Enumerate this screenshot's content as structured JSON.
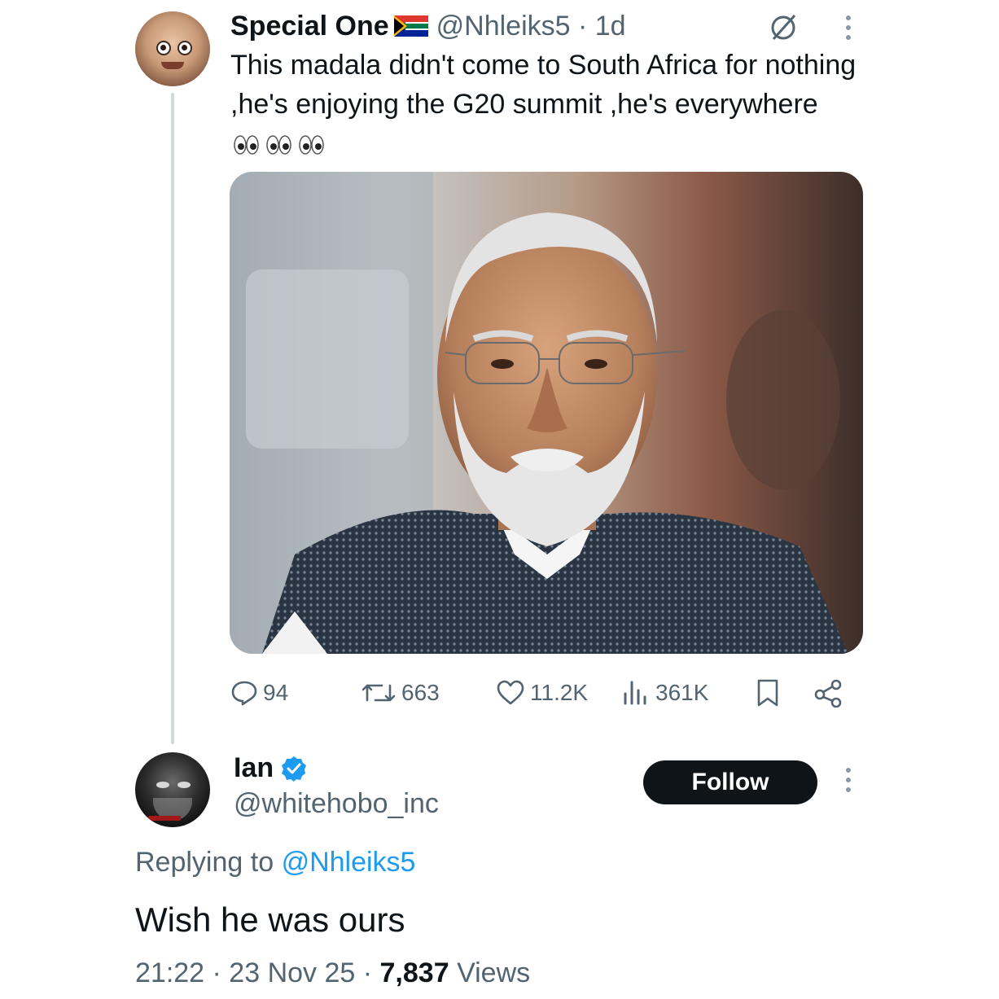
{
  "tweet": {
    "author_name": "Special One",
    "handle_time": "@Nhleiks5 · 1d",
    "text": "This madala didn't come to South Africa for nothing ,he's enjoying the G20 summit ,he's everywhere",
    "stats": {
      "replies": "94",
      "reposts": "663",
      "likes": "11.2K",
      "views": "361K"
    }
  },
  "reply": {
    "author_name": "Ian",
    "handle": "@whitehobo_inc",
    "follow_label": "Follow",
    "replying_prefix": "Replying to",
    "replying_handle": "@Nhleiks5",
    "text": "Wish he was ours",
    "time_date": "21:22 · 23 Nov 25 ·",
    "views_count": "7,837",
    "views_label": "Views"
  },
  "colors": {
    "accent": "#1d9bf0",
    "text": "#0f1419",
    "secondary": "#536471"
  },
  "icons": [
    "south-africa-flag-icon",
    "grok-icon",
    "more-icon",
    "eyes-emoji-icon",
    "reply-icon",
    "repost-icon",
    "like-icon",
    "views-icon",
    "bookmark-icon",
    "share-icon",
    "verified-badge-icon"
  ]
}
